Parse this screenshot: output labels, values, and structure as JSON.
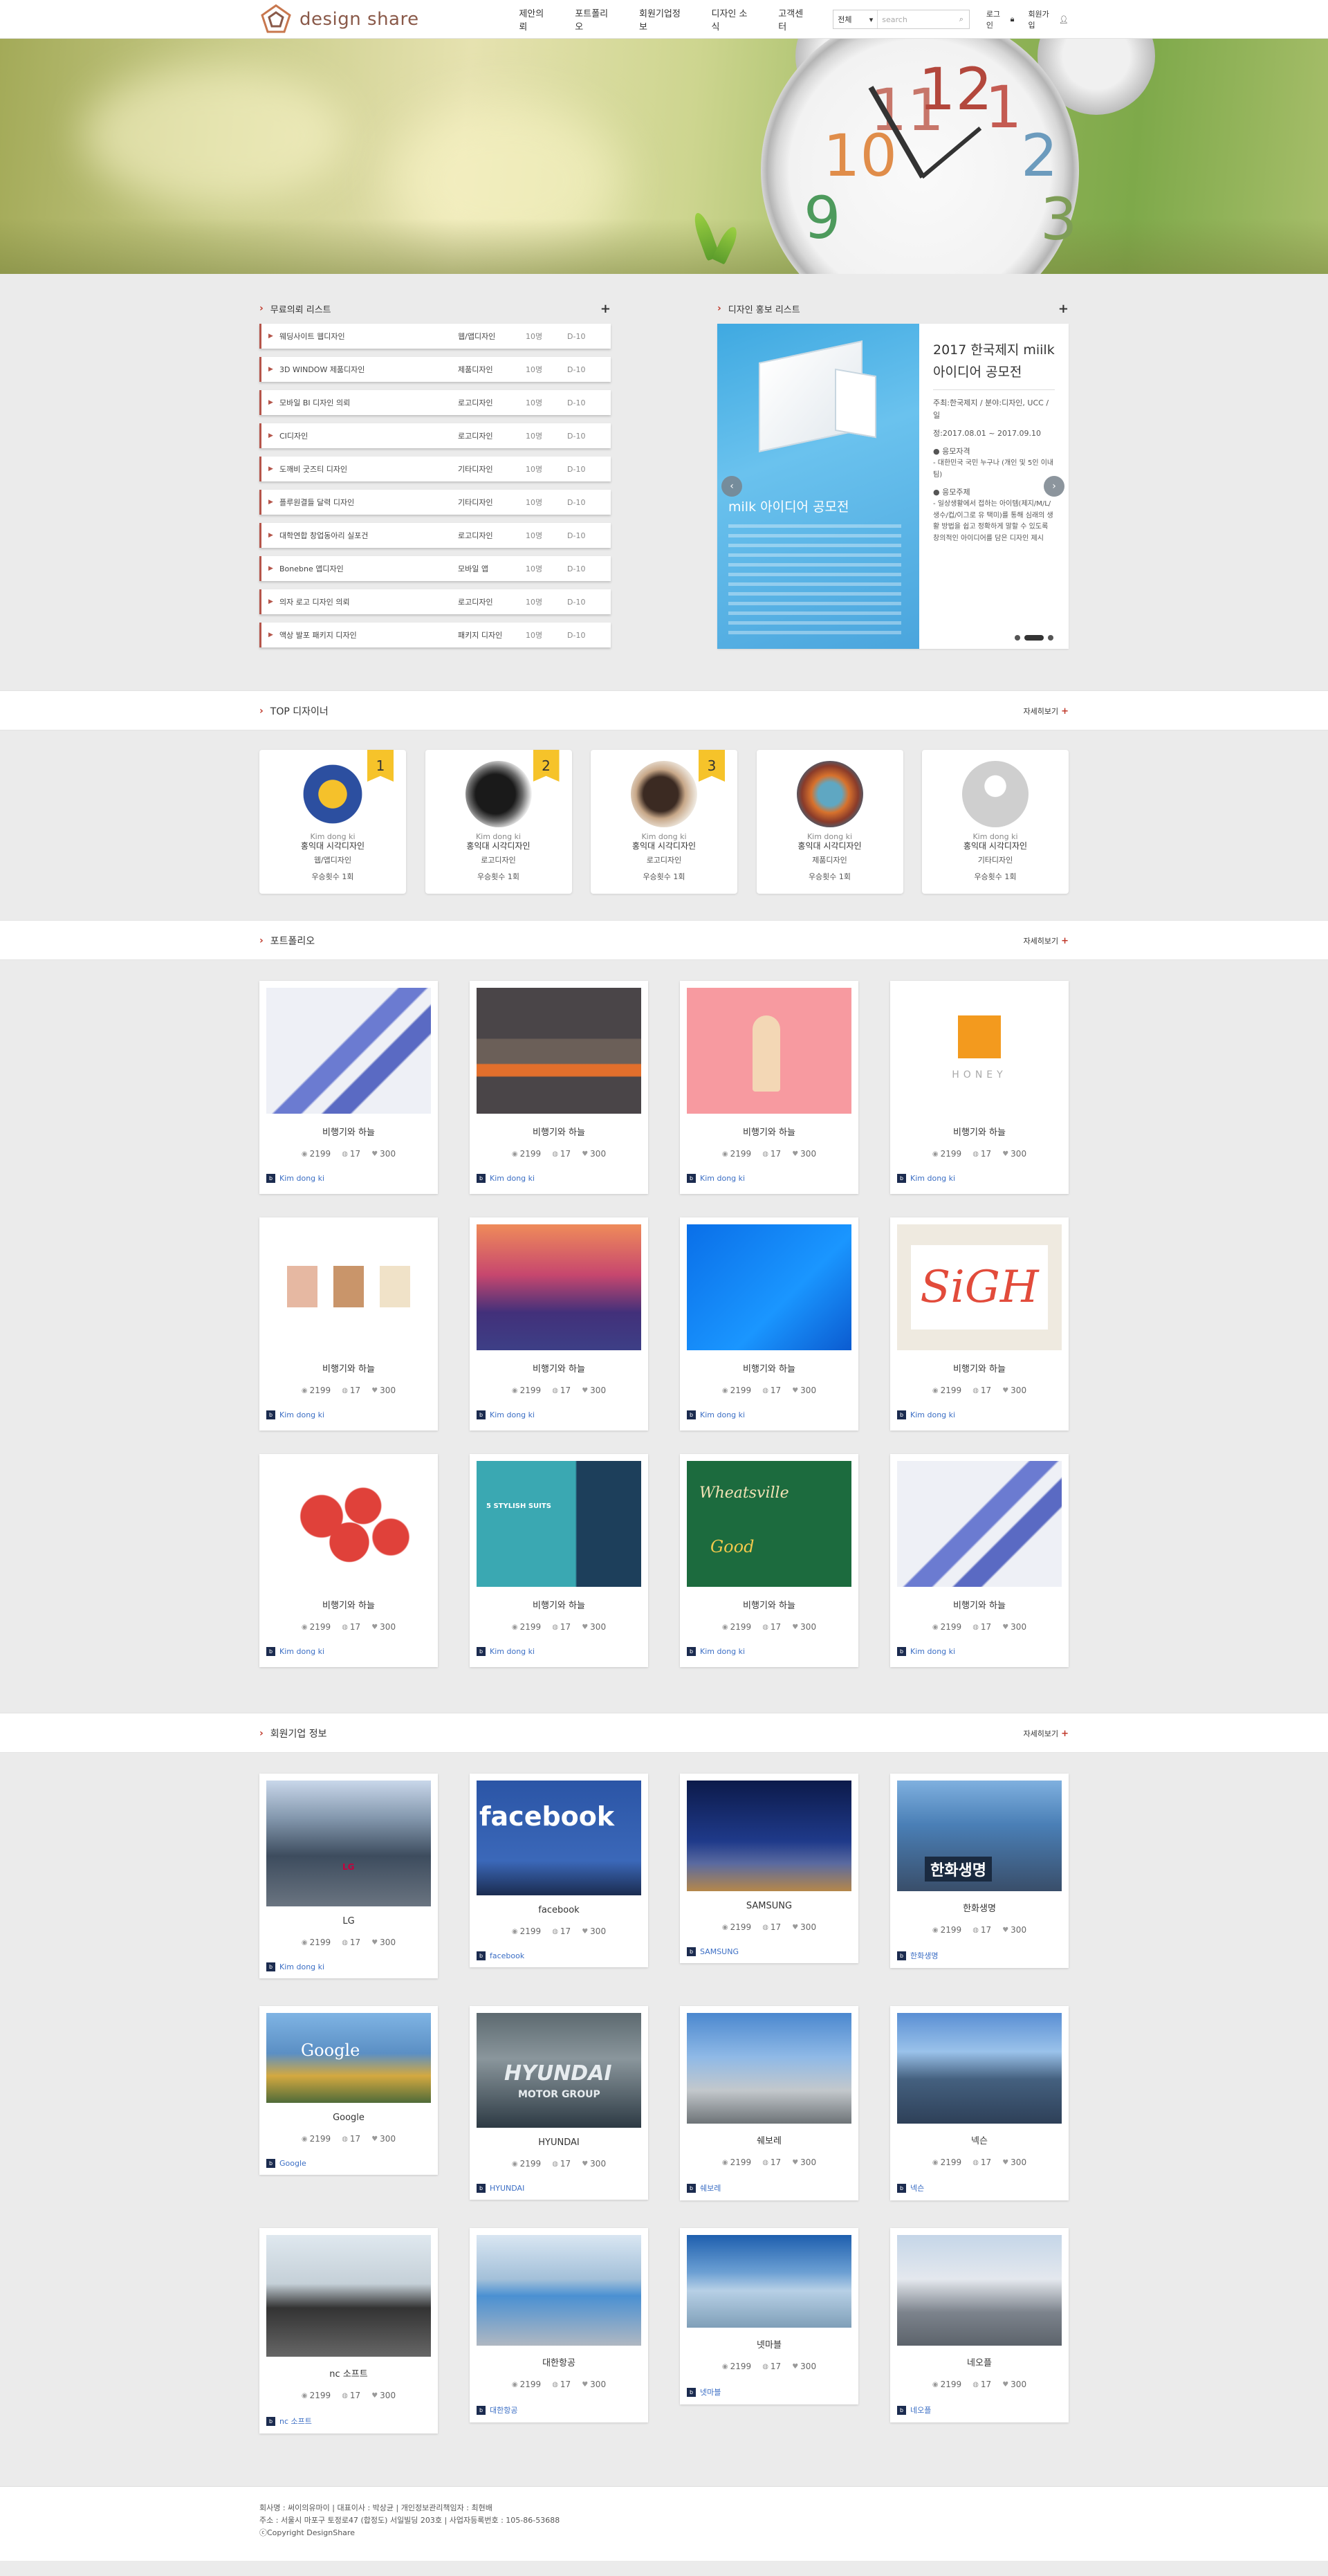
{
  "header": {
    "logo": "design share",
    "nav": [
      "제안의뢰",
      "포트폴리오",
      "회원기업정보",
      "디자인 소식",
      "고객센터"
    ],
    "search_select": "전체",
    "search_placeholder": "search",
    "login": "로그인",
    "join": "회원가입"
  },
  "sections": {
    "requests_title": "무료의뢰 리스트",
    "promo_title": "디자인 홍보 리스트",
    "designers_title": "TOP 디자이너",
    "portfolio_title": "포트폴리오",
    "company_title": "회원기업 정보",
    "more": "자세히보기"
  },
  "requests": [
    {
      "name": "웨딩사이트 웹디자인",
      "cat": "웹/앱디자인",
      "people": "10명",
      "dday": "D-10"
    },
    {
      "name": "3D WINDOW 제품디자인",
      "cat": "제품디자인",
      "people": "10명",
      "dday": "D-10"
    },
    {
      "name": "모바일 BI 디자인 의뢰",
      "cat": "로고디자인",
      "people": "10명",
      "dday": "D-10"
    },
    {
      "name": "CI디자인",
      "cat": "로고디자인",
      "people": "10명",
      "dday": "D-10"
    },
    {
      "name": "도깨비 굿즈티 디자인",
      "cat": "기타디자인",
      "people": "10명",
      "dday": "D-10"
    },
    {
      "name": "플루원결들 달력 디자인",
      "cat": "기타디자인",
      "people": "10명",
      "dday": "D-10"
    },
    {
      "name": "대학연합 창업동아리 실포건",
      "cat": "로고디자인",
      "people": "10명",
      "dday": "D-10"
    },
    {
      "name": "Bonebne 앱디자인",
      "cat": "모바일 앱",
      "people": "10명",
      "dday": "D-10"
    },
    {
      "name": "의자 로고 디자인 의뢰",
      "cat": "로고디자인",
      "people": "10명",
      "dday": "D-10"
    },
    {
      "name": "액상 발포 패키지 디자인",
      "cat": "패키지 디자인",
      "people": "10명",
      "dday": "D-10"
    }
  ],
  "promo": {
    "image_title": "milk 아이디어 공모전",
    "title": "2017 한국제지 miilk 아이디어 공모전",
    "host": "주최:한국제지 / 분야:디자인, UCC / 일",
    "period": "정:2017.08.01 ~ 2017.09.10",
    "target_h": "● 응모자격",
    "target": "- 대한민국 국민 누구나 (개인 및 5인 이내 팀)",
    "theme_h": "● 응모주제",
    "theme": "- 일상생활에서 접하는 아이템(제지/M/L/생수/컵/이그로 유 택미)를 통해 심래의 생활 방법을 쉽고 정확하게 말할 수 있도록 창의적인 아이디어를 담은 디자인 제시"
  },
  "designers": [
    {
      "rank": "1",
      "name": "Kim dong ki",
      "school": "홍익대 시각디자인",
      "cat": "웹/앱디자인",
      "award": "우승횟수 1회"
    },
    {
      "rank": "2",
      "name": "Kim dong ki",
      "school": "홍익대 시각디자인",
      "cat": "로고디자인",
      "award": "우승횟수 1회"
    },
    {
      "rank": "3",
      "name": "Kim dong ki",
      "school": "홍익대 시각디자인",
      "cat": "로고디자인",
      "award": "우승횟수 1회"
    },
    {
      "rank": "",
      "name": "Kim dong ki",
      "school": "홍익대 시각디자인",
      "cat": "제품디자인",
      "award": "우승횟수 1회"
    },
    {
      "rank": "",
      "name": "Kim dong ki",
      "school": "홍익대 시각디자인",
      "cat": "기타디자인",
      "award": "우승횟수 1회"
    }
  ],
  "portfolio": [
    {
      "title": "비행기와 하늘",
      "views": "2199",
      "comments": "17",
      "likes": "300",
      "owner": "Kim dong ki"
    },
    {
      "title": "비행기와 하늘",
      "views": "2199",
      "comments": "17",
      "likes": "300",
      "owner": "Kim dong ki"
    },
    {
      "title": "비행기와 하늘",
      "views": "2199",
      "comments": "17",
      "likes": "300",
      "owner": "Kim dong ki"
    },
    {
      "title": "비행기와 하늘",
      "views": "2199",
      "comments": "17",
      "likes": "300",
      "owner": "Kim dong ki"
    },
    {
      "title": "비행기와 하늘",
      "views": "2199",
      "comments": "17",
      "likes": "300",
      "owner": "Kim dong ki"
    },
    {
      "title": "비행기와 하늘",
      "views": "2199",
      "comments": "17",
      "likes": "300",
      "owner": "Kim dong ki"
    },
    {
      "title": "비행기와 하늘",
      "views": "2199",
      "comments": "17",
      "likes": "300",
      "owner": "Kim dong ki"
    },
    {
      "title": "비행기와 하늘",
      "views": "2199",
      "comments": "17",
      "likes": "300",
      "owner": "Kim dong ki"
    },
    {
      "title": "비행기와 하늘",
      "views": "2199",
      "comments": "17",
      "likes": "300",
      "owner": "Kim dong ki"
    },
    {
      "title": "비행기와 하늘",
      "views": "2199",
      "comments": "17",
      "likes": "300",
      "owner": "Kim dong ki"
    },
    {
      "title": "비행기와 하늘",
      "views": "2199",
      "comments": "17",
      "likes": "300",
      "owner": "Kim dong ki"
    },
    {
      "title": "비행기와 하늘",
      "views": "2199",
      "comments": "17",
      "likes": "300",
      "owner": "Kim dong ki"
    }
  ],
  "portfolio_extra": {
    "honey": "HONEY",
    "sign": "SiGH",
    "stylish": "5 STYLISH SUITS",
    "food": "Wheatsville",
    "food2": "Good"
  },
  "companies": [
    {
      "name": "LG",
      "views": "2199",
      "comments": "17",
      "likes": "300",
      "owner": "Kim dong ki"
    },
    {
      "name": "facebook",
      "views": "2199",
      "comments": "17",
      "likes": "300",
      "owner": "facebook"
    },
    {
      "name": "SAMSUNG",
      "views": "2199",
      "comments": "17",
      "likes": "300",
      "owner": "SAMSUNG"
    },
    {
      "name": "한화생명",
      "views": "2199",
      "comments": "17",
      "likes": "300",
      "owner": "한화생명"
    },
    {
      "name": "Google",
      "views": "2199",
      "comments": "17",
      "likes": "300",
      "owner": "Google"
    },
    {
      "name": "HYUNDAI",
      "views": "2199",
      "comments": "17",
      "likes": "300",
      "owner": "HYUNDAI"
    },
    {
      "name": "쉐보레",
      "views": "2199",
      "comments": "17",
      "likes": "300",
      "owner": "쉐보레"
    },
    {
      "name": "넥슨",
      "views": "2199",
      "comments": "17",
      "likes": "300",
      "owner": "넥슨"
    },
    {
      "name": "nc 소프트",
      "views": "2199",
      "comments": "17",
      "likes": "300",
      "owner": "nc 소프트"
    },
    {
      "name": "대한항공",
      "views": "2199",
      "comments": "17",
      "likes": "300",
      "owner": "대한항공"
    },
    {
      "name": "넷마블",
      "views": "2199",
      "comments": "17",
      "likes": "300",
      "owner": "넷마블"
    },
    {
      "name": "네오플",
      "views": "2199",
      "comments": "17",
      "likes": "300",
      "owner": "네오플"
    }
  ],
  "company_extra": {
    "fb": "facebook",
    "google": "Google",
    "hyundai": "HYUNDAI",
    "hyundai2": "MOTOR GROUP",
    "hanwha": "한화생명",
    "lg": "LG"
  },
  "footer": {
    "line1": "회사명 : 써이의유마이  |  대표이사 : 박상균  |  개인정보관리책임자 : 최현배",
    "line2": "주소 : 서울시 마포구 토정로47 (합정도) 서일빌딩 203호  |  사업자등록번호 : 105-86-53688",
    "line3": "ⓒCopyright DesignShare"
  },
  "hero": {
    "nums": [
      "11",
      "12",
      "1",
      "10",
      "2",
      "9",
      "3"
    ]
  }
}
